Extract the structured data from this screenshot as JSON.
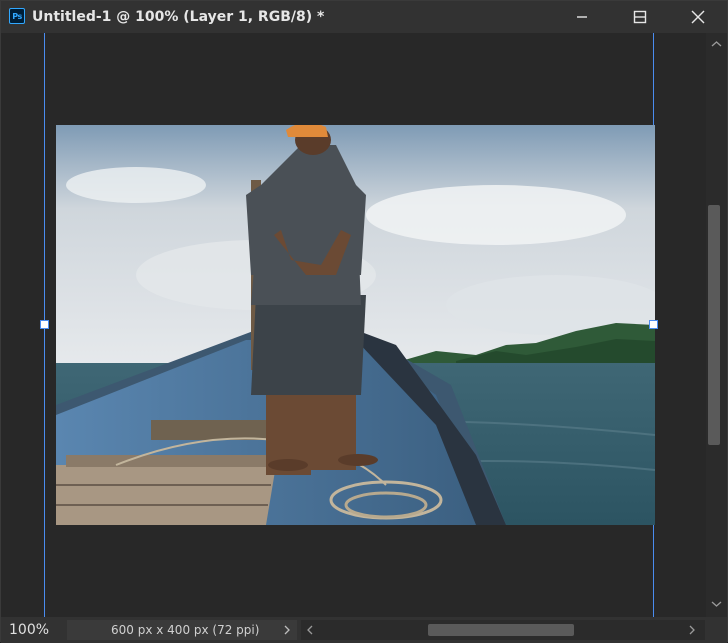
{
  "app": {
    "icon_label": "Ps",
    "title": "Untitled-1 @ 100% (Layer 1, RGB/8) *"
  },
  "window_controls": {
    "minimize": "minimize-icon",
    "maximize": "maximize-icon",
    "close": "close-icon"
  },
  "canvas": {
    "image_description": "Man in orange cap standing at the bow of a weathered blue wooden boat looking out to sea toward a green island under a cloudy sky",
    "guide_color": "#4a8cf0"
  },
  "status": {
    "zoom": "100%",
    "doc_info": "600 px x 400 px (72 ppi)"
  },
  "colors": {
    "background": "#282828",
    "titlebar": "#323232",
    "accent": "#31a8ff"
  }
}
